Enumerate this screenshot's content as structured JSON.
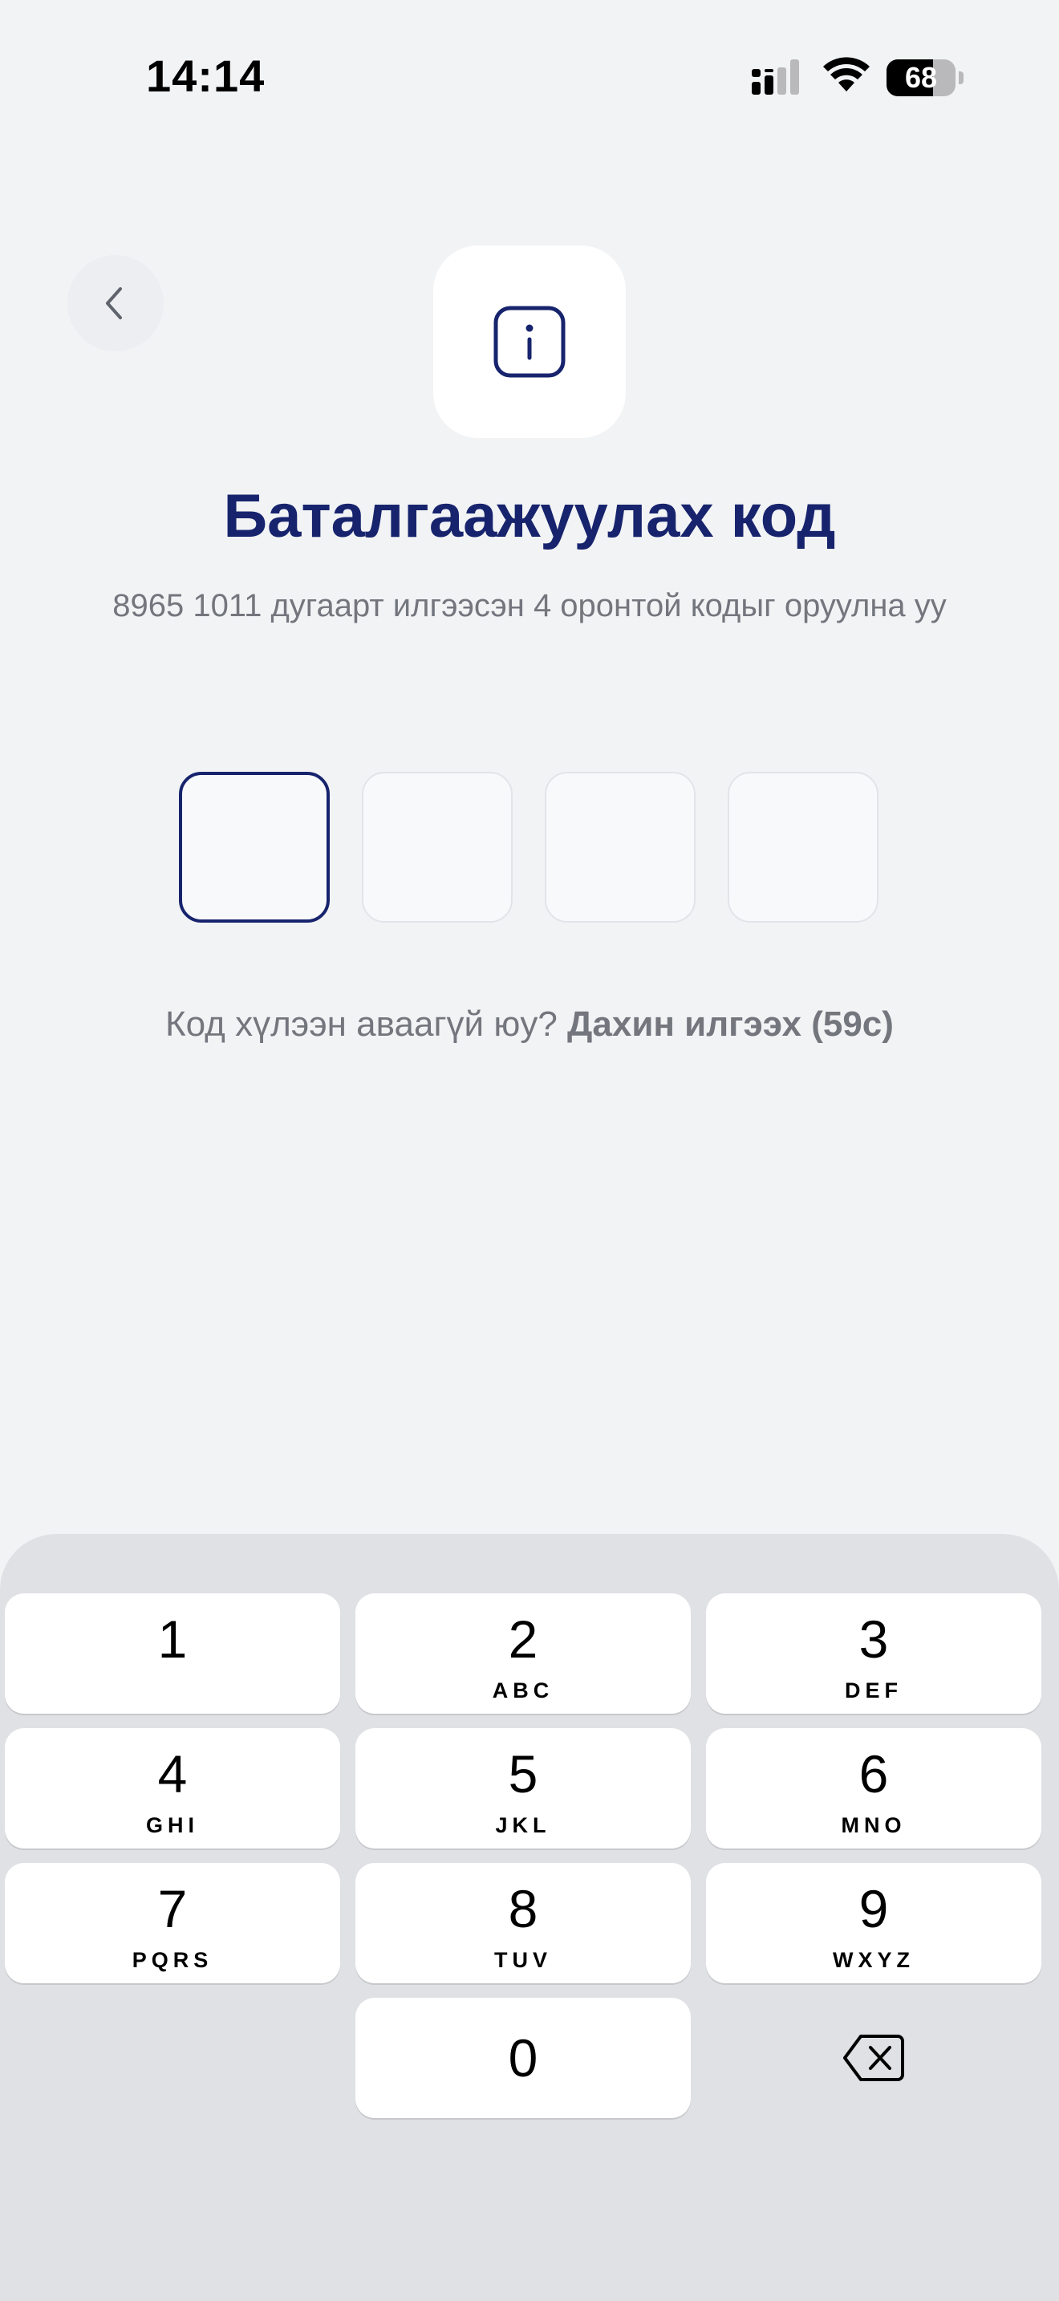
{
  "status_bar": {
    "time": "14:14",
    "battery_level": 68,
    "battery_text": "68"
  },
  "header": {
    "back_icon": "chevron-left-icon",
    "tile_icon": "info-icon",
    "title": "Баталгаажуулах код",
    "subtitle": "8965 1011 дугаарт илгээсэн 4 оронтой кодыг оруулна уу"
  },
  "code_input": {
    "length": 4,
    "active_index": 0,
    "values": [
      "",
      "",
      "",
      ""
    ]
  },
  "resend": {
    "prompt": "Код хүлээн аваагүй юу?",
    "link_label": "Дахин илгээх (59с)"
  },
  "keypad": {
    "keys": [
      {
        "digit": "1",
        "letters": ""
      },
      {
        "digit": "2",
        "letters": "ABC"
      },
      {
        "digit": "3",
        "letters": "DEF"
      },
      {
        "digit": "4",
        "letters": "GHI"
      },
      {
        "digit": "5",
        "letters": "JKL"
      },
      {
        "digit": "6",
        "letters": "MNO"
      },
      {
        "digit": "7",
        "letters": "PQRS"
      },
      {
        "digit": "8",
        "letters": "TUV"
      },
      {
        "digit": "9",
        "letters": "WXYZ"
      },
      {
        "digit": "0",
        "letters": ""
      }
    ],
    "delete_icon": "backspace-icon"
  },
  "colors": {
    "accent": "#17246d",
    "background": "#f2f3f5",
    "muted_text": "#73767d",
    "keypad_bg": "#e0e1e5"
  }
}
